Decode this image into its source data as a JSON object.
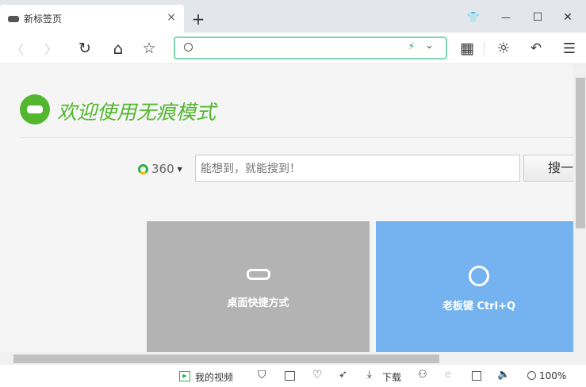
{
  "tab": {
    "title": "新标签页",
    "close": "×",
    "new_tab": "+"
  },
  "window": {
    "skin": "👕",
    "minimize": "—",
    "maximize": "☐",
    "close": "✕"
  },
  "toolbar": {
    "back": "〈",
    "forward": "〉",
    "reload": "↻",
    "home": "⌂",
    "star": "☆",
    "apps": "▦",
    "brightness": "☼",
    "undo": "↶",
    "menu": "☰"
  },
  "address": {
    "value": "",
    "placeholder": ""
  },
  "welcome": {
    "title": "欢迎使用无痕模式"
  },
  "search": {
    "engine": "360",
    "placeholder": "能想到，就能搜到！",
    "button": "搜一下"
  },
  "tiles": [
    {
      "label": "桌面快捷方式",
      "color": "#b3b3b3"
    },
    {
      "label": "老板键 Ctrl+Q",
      "color": "#74b3f0"
    }
  ],
  "status": {
    "video": "我的视频",
    "download": "下载",
    "zoom": "100%"
  },
  "colors": {
    "accent": "#52b72f",
    "address_border": "#7fd8b0"
  }
}
